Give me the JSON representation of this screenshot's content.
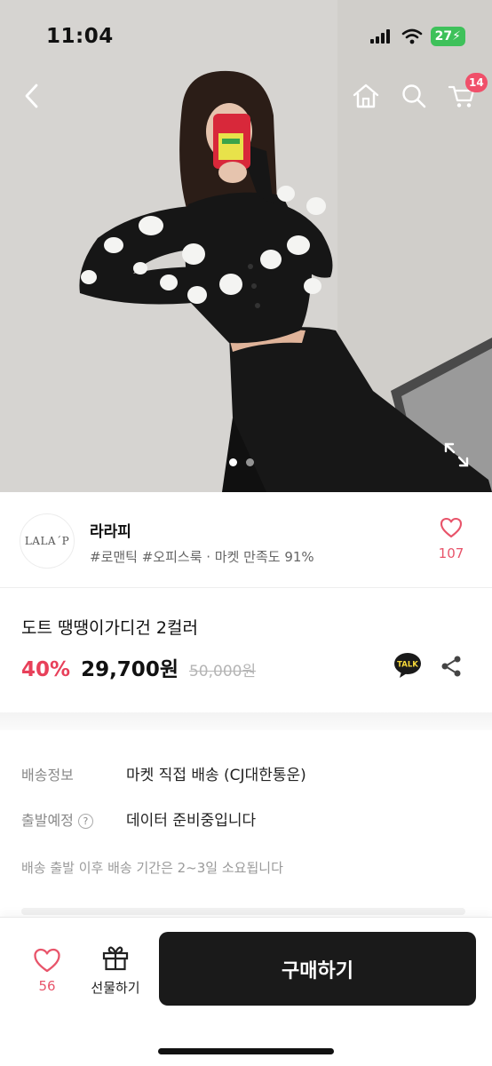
{
  "status_bar": {
    "time": "11:04",
    "battery": "27"
  },
  "header": {
    "cart_count": "14"
  },
  "gallery": {
    "total_images": 2,
    "active_index": 0
  },
  "seller": {
    "logo_text": "LALA´P",
    "name": "라라피",
    "tags": "#로맨틱 #오피스룩 · 마켓 만족도 91%",
    "likes": "107"
  },
  "product": {
    "title": "도트 땡땡이가디건 2컬러",
    "discount": "40%",
    "price": "29,700원",
    "original_price": "50,000원",
    "talk_label": "TALK"
  },
  "shipping": {
    "info_label": "배송정보",
    "info_value": "마켓 직접 배송 (CJ대한통운)",
    "departure_label": "출발예정",
    "departure_help": "?",
    "departure_value": "데이터 준비중입니다",
    "note": "배송 출발 이후 배송 기간은 2~3일 소요됩니다"
  },
  "bottom_bar": {
    "likes": "56",
    "gift_label": "선물하기",
    "buy_label": "구매하기"
  },
  "colors": {
    "accent": "#e8405a",
    "heart": "#e8546a",
    "buy_button": "#1a1a1a",
    "battery": "#3ec15a"
  }
}
